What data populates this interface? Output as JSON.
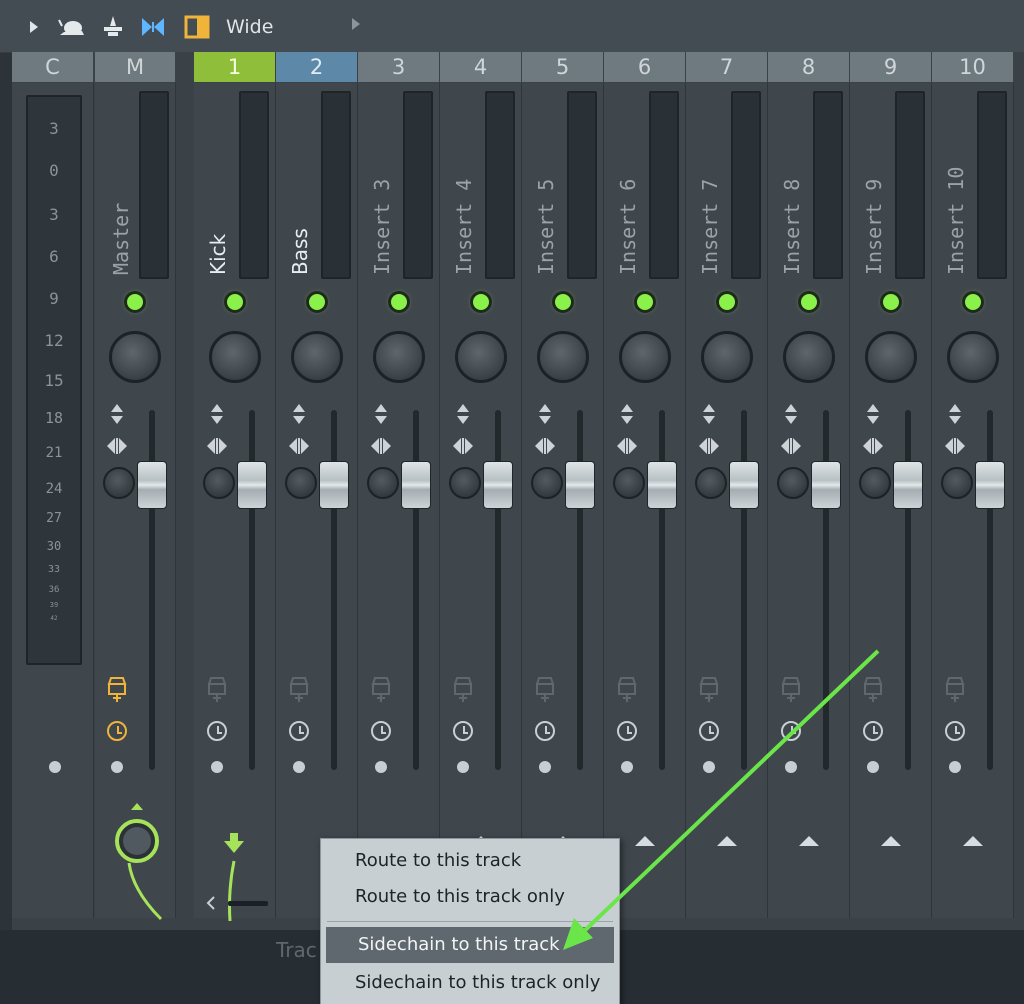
{
  "toolbar": {
    "view_label": "Wide",
    "icons": [
      "play-arrow-icon",
      "snail-icon",
      "stamp-icon",
      "bowtie-icon",
      "window-layout-icon",
      "dropdown-arrow-icon"
    ]
  },
  "mixer": {
    "current_track": "C",
    "master_track": "M",
    "meter_scale": [
      "3",
      "0",
      "3",
      "6",
      "9",
      "12",
      "15",
      "18",
      "21",
      "24",
      "27",
      "30",
      "33",
      "36",
      "39",
      "42"
    ],
    "inserts": [
      {
        "number": "1",
        "name": "Kick",
        "selected": true
      },
      {
        "number": "2",
        "name": "Bass",
        "selected": false
      },
      {
        "number": "3",
        "name": "Insert 3",
        "selected": false
      },
      {
        "number": "4",
        "name": "Insert 4",
        "selected": false
      },
      {
        "number": "5",
        "name": "Insert 5",
        "selected": false
      },
      {
        "number": "6",
        "name": "Insert 6",
        "selected": false
      },
      {
        "number": "7",
        "name": "Insert 7",
        "selected": false
      },
      {
        "number": "8",
        "name": "Insert 8",
        "selected": false
      },
      {
        "number": "9",
        "name": "Insert 9",
        "selected": false
      },
      {
        "number": "10",
        "name": "Insert 10",
        "selected": false
      }
    ],
    "master_name": "Master"
  },
  "context_menu": {
    "items": [
      {
        "label": "Route to this track",
        "highlighted": false
      },
      {
        "label": "Route to this track only",
        "highlighted": false
      },
      {
        "label": "Sidechain to this track",
        "highlighted": true
      },
      {
        "label": "Sidechain to this track only",
        "highlighted": false
      }
    ]
  },
  "bottom": {
    "partial_label": "Trac"
  },
  "colors": {
    "selected_accent": "#8fbf3a",
    "led_green": "#8af04a",
    "highlight_blue": "#5d88a8",
    "annotation_arrow": "#6be64a"
  }
}
